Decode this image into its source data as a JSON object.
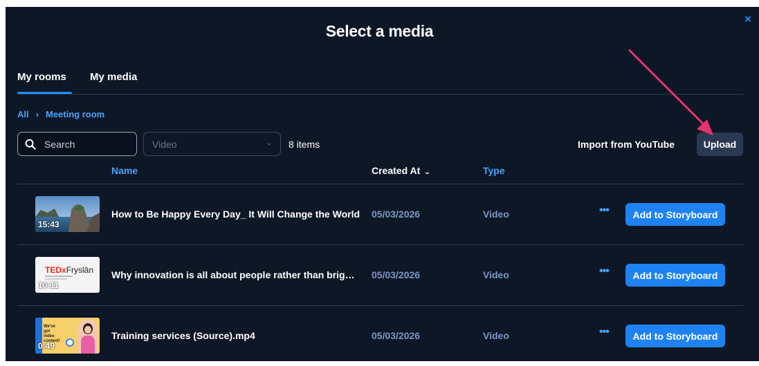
{
  "dialog": {
    "title": "Select a media",
    "close_label": "×"
  },
  "tabs": [
    {
      "label": "My rooms",
      "active": true
    },
    {
      "label": "My media",
      "active": false
    }
  ],
  "breadcrumb": {
    "root": "All",
    "separator": "›",
    "current": "Meeting room"
  },
  "toolbar": {
    "search_placeholder": "Search",
    "type_filter": "Video",
    "item_count": "8 items",
    "import_label": "Import from YouTube",
    "upload_label": "Upload"
  },
  "table": {
    "columns": {
      "name": "Name",
      "created_at": "Created At",
      "type": "Type"
    },
    "rows": [
      {
        "thumbnail_duration": "15:43",
        "name": "How to Be Happy Every Day_ It Will Change the World",
        "created_at": "05/03/2026",
        "type": "Video",
        "more_label": "•••",
        "action_label": "Add to Storyboard"
      },
      {
        "thumbnail_duration": "10:11",
        "thumbnail_brand": "TEDx",
        "thumbnail_brand_suffix": "Fryslân",
        "name": "Why innovation is all about people rather than bright ideas",
        "created_at": "05/03/2026",
        "type": "Video",
        "more_label": "•••",
        "action_label": "Add to Storyboard"
      },
      {
        "thumbnail_duration": "0:49",
        "thumbnail_caption": "We've got video content!",
        "name": "Training services (Source).mp4",
        "created_at": "05/03/2026",
        "type": "Video",
        "more_label": "•••",
        "action_label": "Add to Storyboard"
      }
    ]
  },
  "colors": {
    "background": "#0e1726",
    "accent": "#1f82f2",
    "link": "#4aa3ff",
    "muted": "#7c98c4",
    "annotation_arrow": "#e8336f"
  }
}
